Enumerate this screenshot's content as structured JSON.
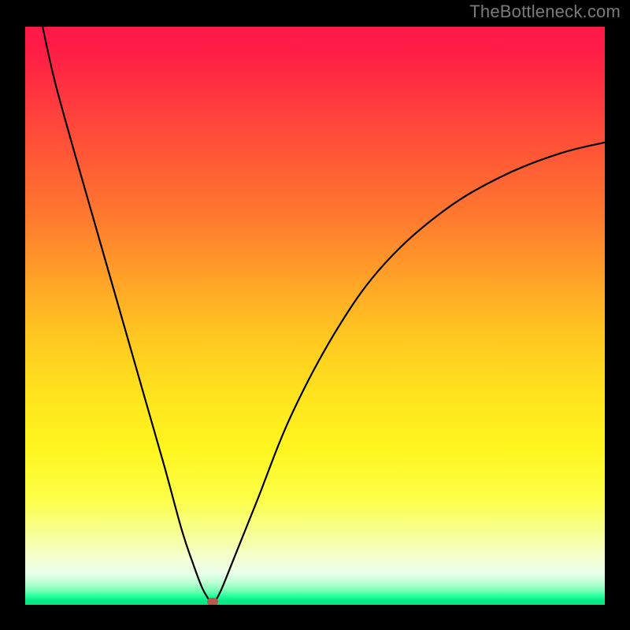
{
  "attribution": "TheBottleneck.com",
  "colors": {
    "frame": "#000000",
    "curve": "#000000",
    "min_dot": "#b65a4a",
    "attribution_text": "#7b7b7b",
    "gradient_top": "#ff1a47",
    "gradient_bottom": "#07e984"
  },
  "chart_data": {
    "type": "line",
    "title": "",
    "xlabel": "",
    "ylabel": "",
    "xlim": [
      0,
      100
    ],
    "ylim": [
      0,
      100
    ],
    "annotations": [],
    "series": [
      {
        "name": "bottleneck-curve",
        "x": [
          3,
          5,
          8,
          12,
          16,
          20,
          24,
          27,
          29,
          30.5,
          31.5,
          32,
          32.4,
          33,
          34,
          36,
          40,
          46,
          54,
          62,
          72,
          82,
          92,
          100
        ],
        "y": [
          100,
          91,
          80,
          66,
          52,
          38,
          24,
          13,
          7,
          3,
          1.2,
          0.6,
          0.5,
          1,
          3,
          8,
          18,
          33,
          48,
          59,
          68,
          74,
          78,
          80
        ]
      }
    ],
    "min_point": {
      "x": 32.4,
      "y": 0.5
    }
  }
}
